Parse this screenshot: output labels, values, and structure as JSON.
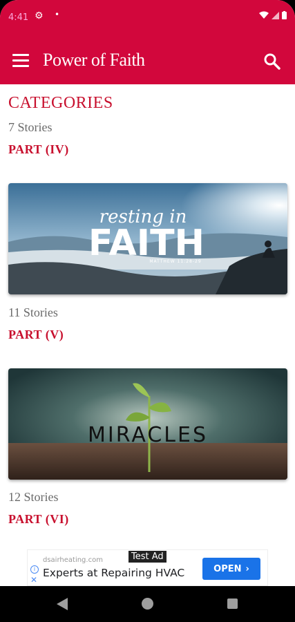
{
  "status": {
    "time": "4:41"
  },
  "app": {
    "title": "Power of Faith"
  },
  "section": {
    "title": "CATEGORIES"
  },
  "items": [
    {
      "stories": "7 Stories",
      "part": "PART (IV)"
    },
    {
      "stories": "11 Stories",
      "part": "PART (V)",
      "image_word_top": "resting in",
      "image_word_main": "FAITH",
      "image_sub": "MATTHEW 11:28-29"
    },
    {
      "stories": "12 Stories",
      "part": "PART (VI)",
      "image_word_main": "MIRACLES"
    }
  ],
  "ad": {
    "domain": "dsairheating.com",
    "tag": "Test Ad",
    "headline": "Experts at Repairing HVAC",
    "button": "OPEN"
  },
  "colors": {
    "primary": "#d2073c",
    "accent_text": "#c8102e",
    "ad_button": "#1a73e8"
  }
}
